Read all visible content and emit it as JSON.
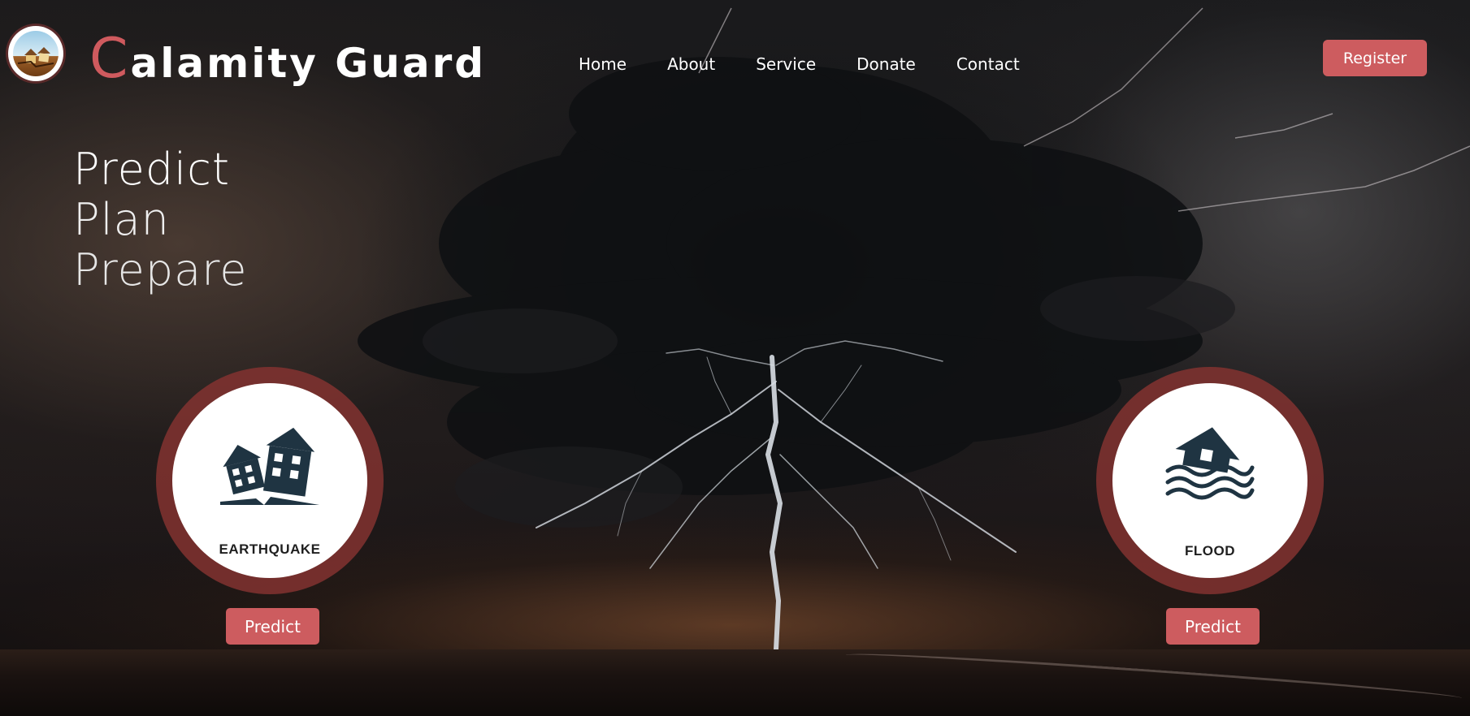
{
  "brand": {
    "initial": "C",
    "rest": "alamity Guard"
  },
  "nav": {
    "items": [
      {
        "label": "Home"
      },
      {
        "label": "About"
      },
      {
        "label": "Service"
      },
      {
        "label": "Donate"
      },
      {
        "label": "Contact"
      }
    ]
  },
  "header": {
    "register_label": "Register"
  },
  "tagline": {
    "line1": "Predict",
    "line2": "Plan",
    "line3": "Prepare"
  },
  "cards": [
    {
      "label": "EARTHQUAKE",
      "icon": "earthquake-houses-icon",
      "button_label": "Predict"
    },
    {
      "label": "FLOOD",
      "icon": "flooded-house-icon",
      "button_label": "Predict"
    }
  ],
  "colors": {
    "accent": "#cd5c5f",
    "card_ring": "#82322f",
    "icon": "#1f3442"
  }
}
